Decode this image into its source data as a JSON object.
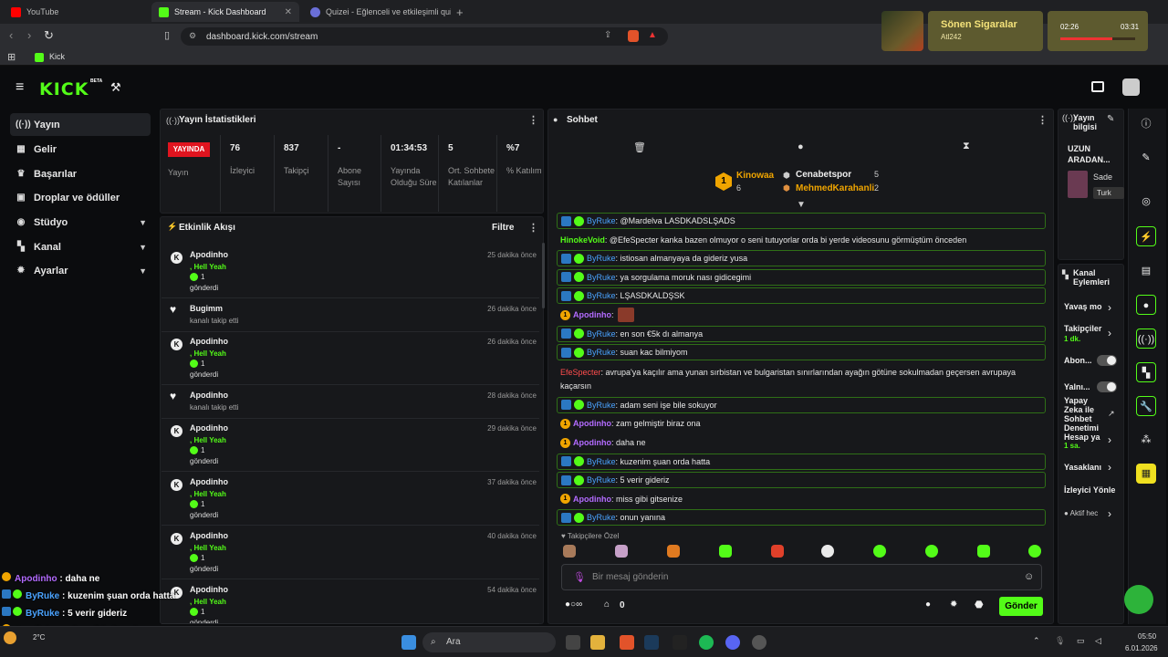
{
  "browser": {
    "tabs": [
      {
        "label": "YouTube"
      },
      {
        "label": "Stream - Kick Dashboard"
      },
      {
        "label": "Quizei - Eğlenceli ve etkileşimli quizle"
      }
    ],
    "url": "dashboard.kick.com/stream",
    "bookmark": "Kick"
  },
  "overlay": {
    "now_playing_title": "Sönen Sigaralar",
    "now_playing_artist": "Atl242",
    "timer_elapsed": "02:26",
    "timer_total": "03:31",
    "timer_progress": 0.69
  },
  "app": {
    "logo": "KICK",
    "beta": "BETA"
  },
  "sidebar": {
    "items": [
      {
        "label": "Yayın",
        "icon": "broadcast-icon"
      },
      {
        "label": "Gelir",
        "icon": "revenue-icon"
      },
      {
        "label": "Başarılar",
        "icon": "trophy-icon"
      },
      {
        "label": "Droplar ve ödüller",
        "icon": "gift-icon"
      },
      {
        "label": "Stüdyo",
        "icon": "studio-icon"
      },
      {
        "label": "Kanal",
        "icon": "channel-icon"
      },
      {
        "label": "Ayarlar",
        "icon": "gear-icon"
      }
    ]
  },
  "stats": {
    "title": "Yayın İstatistikleri",
    "live_badge": "YAYINDA",
    "live_label": "Yayın",
    "columns": [
      {
        "value": "76",
        "label": "İzleyici"
      },
      {
        "value": "837",
        "label": "Takipçi"
      },
      {
        "value": "-",
        "label": "Abone Sayısı"
      },
      {
        "value": "01:34:53",
        "label": "Yayında Olduğu Süre"
      },
      {
        "value": "5",
        "label": "Ort. Sohbete Katılanlar"
      },
      {
        "value": "%7",
        "label": "% Katılım"
      }
    ]
  },
  "activity": {
    "title": "Etkinlik Akışı",
    "filter_label": "Filtre",
    "events": [
      {
        "name": "Apodinho",
        "sub": ", Hell Yeah",
        "count": "1",
        "action": "gönderdi",
        "time": "25 dakika önce",
        "kind": "kick"
      },
      {
        "name": "Bugimm",
        "action": "kanalı takip etti",
        "time": "26 dakika önce",
        "kind": "follow"
      },
      {
        "name": "Apodinho",
        "sub": ", Hell Yeah",
        "count": "1",
        "action": "gönderdi",
        "time": "26 dakika önce",
        "kind": "kick"
      },
      {
        "name": "Apodinho",
        "action": "kanalı takip etti",
        "time": "28 dakika önce",
        "kind": "follow"
      },
      {
        "name": "Apodinho",
        "sub": ", Hell Yeah",
        "count": "1",
        "action": "gönderdi",
        "time": "29 dakika önce",
        "kind": "kick"
      },
      {
        "name": "Apodinho",
        "sub": ", Hell Yeah",
        "count": "1",
        "action": "gönderdi",
        "time": "37 dakika önce",
        "kind": "kick"
      },
      {
        "name": "Apodinho",
        "sub": ", Hell Yeah",
        "count": "1",
        "action": "gönderdi",
        "time": "40 dakika önce",
        "kind": "kick"
      },
      {
        "name": "Apodinho",
        "sub": ", Hell Yeah",
        "count": "1",
        "action": "gönderdi",
        "time": "54 dakika önce",
        "kind": "kick"
      }
    ]
  },
  "chat": {
    "title": "Sohbet",
    "leaderboard": [
      {
        "rank": "1",
        "name": "Kinowaa",
        "score": "6"
      },
      {
        "rank": "",
        "name": "Cenabetspor",
        "score": "5"
      },
      {
        "rank": "",
        "name": "MehmedKarahanli",
        "score": "2"
      }
    ],
    "messages": [
      {
        "user": "ByRuke",
        "text": ": @Mardelva LASDKADSLŞADS",
        "style": "blue",
        "boxed": true,
        "badges": "sub"
      },
      {
        "user": "HinokeVoid",
        "text": ": @EfeSpecter kanka bazen olmuyor o seni tutuyorlar orda bi yerde videosunu görmüştüm önceden",
        "style": "green",
        "boxed": false,
        "badges": ""
      },
      {
        "user": "ByRuke",
        "text": ": istiosan almanyaya da gideriz yusa",
        "style": "blue",
        "boxed": true,
        "badges": "sub"
      },
      {
        "user": "ByRuke",
        "text": ": ya sorgulama moruk nası gidicegimi",
        "style": "blue",
        "boxed": true,
        "badges": "sub"
      },
      {
        "user": "ByRuke",
        "text": ": LŞASDKALDŞSK",
        "style": "blue",
        "boxed": true,
        "badges": "sub"
      },
      {
        "user": "Apodinho",
        "text": ":",
        "style": "purple",
        "boxed": false,
        "badges": "num"
      },
      {
        "user": "ByRuke",
        "text": ": en son €5k dı almanya",
        "style": "blue",
        "boxed": true,
        "badges": "sub"
      },
      {
        "user": "ByRuke",
        "text": ": suan kac bilmiyom",
        "style": "blue",
        "boxed": true,
        "badges": "sub"
      },
      {
        "user": "EfeSpecter",
        "text": ": avrupa'ya kaçılır ama yunan sırbistan ve bulgaristan sınırlarından ayağın götüne sokulmadan geçersen avrupaya",
        "text2": "kaçarsın",
        "style": "red",
        "boxed": false,
        "badges": ""
      },
      {
        "user": "ByRuke",
        "text": ": adam seni işe bile sokuyor",
        "style": "blue",
        "boxed": true,
        "badges": "sub"
      },
      {
        "user": "Apodinho",
        "text": ": zam gelmiştir biraz ona",
        "style": "purple",
        "boxed": false,
        "badges": "num"
      },
      {
        "user": "Apodinho",
        "text": ": daha ne",
        "style": "purple",
        "boxed": false,
        "badges": "num"
      },
      {
        "user": "ByRuke",
        "text": ": kuzenim şuan orda hatta",
        "style": "blue",
        "boxed": true,
        "badges": "sub"
      },
      {
        "user": "ByRuke",
        "text": ": 5 verir gideriz",
        "style": "blue",
        "boxed": true,
        "badges": "sub"
      },
      {
        "user": "Apodinho",
        "text": ": miss gibi gitsenize",
        "style": "purple",
        "boxed": false,
        "badges": "num"
      },
      {
        "user": "ByRuke",
        "text": ": onun yanına",
        "style": "blue",
        "boxed": true,
        "badges": "sub"
      }
    ],
    "emote_section": "Takipçilere Özel",
    "input_placeholder": "Bir mesaj gönderin",
    "points": "0",
    "send_label": "Gönder"
  },
  "stream_info": {
    "title": "Yayın bilgisi",
    "stream_title": "UZUN ARADAN...",
    "category": "Sade",
    "language": "Turk"
  },
  "channel_actions": {
    "title": "Kanal Eylemleri",
    "items": [
      {
        "label": "Yavaş mo",
        "control": "chevron"
      },
      {
        "label": "Takipçiler",
        "sub": "1 dk.",
        "control": "chevron"
      },
      {
        "label": "Abon...",
        "control": "toggle"
      },
      {
        "label": "Yalnı...",
        "control": "toggle"
      },
      {
        "label": "Yapay Zeka ile Sohbet Denetimi Hesap ya",
        "sub": "1 sa.",
        "control": "chevron"
      },
      {
        "label": "Yasaklanı",
        "control": "chevron"
      },
      {
        "label": "İzleyici Yönle",
        "control": "none"
      },
      {
        "label": "Aktif hec",
        "control": "chevron"
      }
    ]
  },
  "overlay_chat": [
    {
      "user": "Apodinho",
      "text": " : zam gelmiştir biraz ona"
    },
    {
      "user": "Apodinho",
      "text": " : daha ne"
    },
    {
      "user": "ByRuke",
      "text": " : kuzenim şuan orda hatta"
    },
    {
      "user": "ByRuke",
      "text": " : 5 verir gideriz"
    },
    {
      "user": "Apodinho",
      "text": " : miss gibi gitsenize"
    },
    {
      "user": "ByRuke",
      "text": " : onun yanına"
    }
  ],
  "taskbar": {
    "search": "Ara",
    "weather": "2°C",
    "time": "05:50",
    "date": "6.01.2026"
  }
}
